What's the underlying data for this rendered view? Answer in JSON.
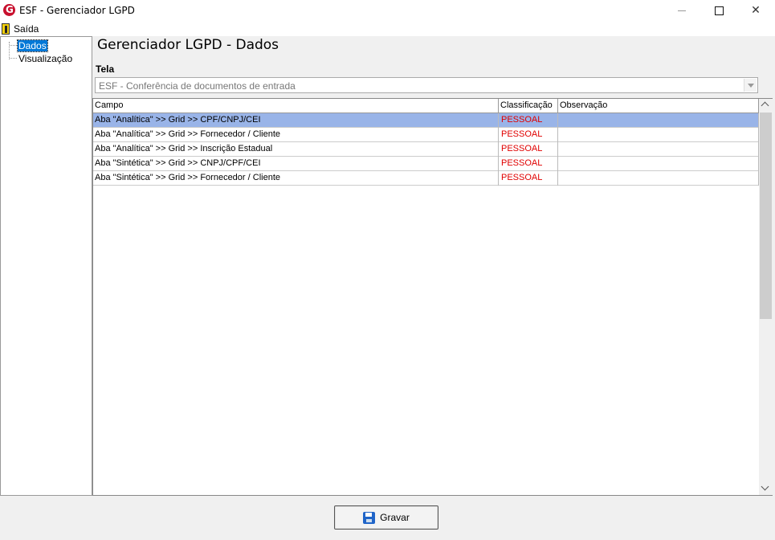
{
  "window": {
    "title": "ESF - Gerenciador LGPD",
    "minimize_glyph": "",
    "close_glyph": "✕"
  },
  "menu": {
    "exit_label": "Saída"
  },
  "tree": {
    "items": [
      {
        "label": "Dados",
        "selected": true
      },
      {
        "label": "Visualização",
        "selected": false
      }
    ]
  },
  "main": {
    "title": "Gerenciador LGPD - Dados",
    "tela_label": "Tela",
    "tela_value": "ESF - Conferência de documentos de entrada"
  },
  "grid": {
    "headers": [
      "Campo",
      "Classificação",
      "Observação"
    ],
    "rows": [
      {
        "campo": "Aba \"Analítica\" >> Grid >> CPF/CNPJ/CEI",
        "classificacao": "PESSOAL",
        "observacao": ""
      },
      {
        "campo": "Aba \"Analítica\" >> Grid >> Fornecedor / Cliente",
        "classificacao": "PESSOAL",
        "observacao": ""
      },
      {
        "campo": "Aba \"Analítica\" >> Grid >> Inscrição Estadual",
        "classificacao": "PESSOAL",
        "observacao": ""
      },
      {
        "campo": "Aba \"Sintética\" >> Grid >>  CNPJ/CPF/CEI",
        "classificacao": "PESSOAL",
        "observacao": ""
      },
      {
        "campo": "Aba \"Sintética\" >> Grid >> Fornecedor / Cliente",
        "classificacao": "PESSOAL",
        "observacao": ""
      }
    ],
    "selected_row": 0
  },
  "footer": {
    "save_label": "Gravar"
  },
  "colors": {
    "selection": "#99b4e8",
    "classification_text": "#e00000",
    "tree_selection": "#0078d7"
  }
}
